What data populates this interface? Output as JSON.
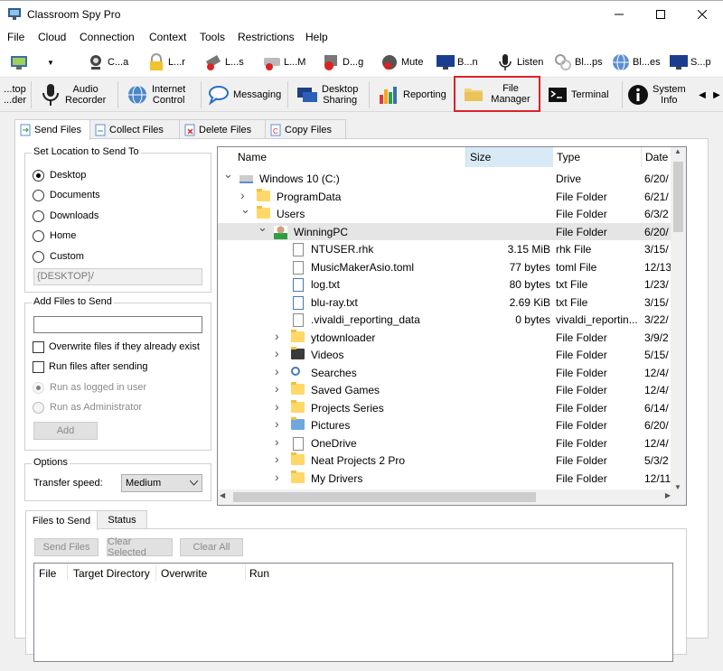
{
  "window": {
    "title": "Classroom Spy Pro"
  },
  "menu": [
    "File",
    "Cloud",
    "Connection",
    "Context",
    "Tools",
    "Restrictions",
    "Help"
  ],
  "toolbar": [
    {
      "label": "",
      "icon": "monitor-icon",
      "has_dropdown": true
    },
    {
      "label": "C...a",
      "icon": "webcam-icon",
      "has_dropdown": true
    },
    {
      "label": "L...r",
      "icon": "lock-icon"
    },
    {
      "label": "L...s",
      "icon": "usb-block-icon"
    },
    {
      "label": "L...M",
      "icon": "drive-block-icon"
    },
    {
      "label": "D...g",
      "icon": "block-icon"
    },
    {
      "label": "Mute",
      "icon": "mute-icon"
    },
    {
      "label": "B...n",
      "icon": "blank-screen-icon"
    },
    {
      "label": "Listen",
      "icon": "microphone-icon"
    },
    {
      "label": "Bl...ps",
      "icon": "block-apps-icon"
    },
    {
      "label": "Bl...es",
      "icon": "block-websites-icon"
    },
    {
      "label": "S...p",
      "icon": "shutdown-icon"
    }
  ],
  "ribbon": [
    {
      "label": "...top\n...der",
      "icon": "desktop-recorder-icon"
    },
    {
      "label": "Audio\nRecorder",
      "icon": "microphone-icon"
    },
    {
      "label": "Internet\nControl",
      "icon": "globe-icon"
    },
    {
      "label": "Messaging",
      "icon": "chat-icon"
    },
    {
      "label": "Desktop\nSharing",
      "icon": "desktop-share-icon"
    },
    {
      "label": "Reporting",
      "icon": "bar-chart-icon"
    },
    {
      "label": "File\nManager",
      "icon": "folder-icon",
      "active": true
    },
    {
      "label": "Terminal",
      "icon": "terminal-icon"
    },
    {
      "label": "System\nInfo",
      "icon": "info-icon"
    }
  ],
  "subtabs": [
    "Send Files",
    "Collect Files",
    "Delete Files",
    "Copy Files"
  ],
  "send_location": {
    "title": "Set Location to Send To",
    "options": [
      "Desktop",
      "Documents",
      "Downloads",
      "Home",
      "Custom"
    ],
    "selected": "Desktop",
    "custom_path": "{DESKTOP}/"
  },
  "add_files": {
    "title": "Add Files to Send",
    "input_value": "",
    "overwrite_label": "Overwrite files if they already exist",
    "run_label": "Run files after sending",
    "run_as_user": "Run as logged in user",
    "run_as_admin": "Run as Administrator",
    "add_button": "Add"
  },
  "options": {
    "title": "Options",
    "transfer_speed_label": "Transfer speed:",
    "transfer_speed": "Medium"
  },
  "file_tree": {
    "columns": [
      "Name",
      "Size",
      "Type",
      "Date"
    ],
    "rows": [
      {
        "name": "Windows 10 (C:)",
        "size": "",
        "type": "Drive",
        "date": "6/20/",
        "level": 0,
        "expander": "expanded",
        "icon": "drive"
      },
      {
        "name": "ProgramData",
        "size": "",
        "type": "File Folder",
        "date": "6/21/",
        "level": 1,
        "expander": "collapsed",
        "icon": "folder"
      },
      {
        "name": "Users",
        "size": "",
        "type": "File Folder",
        "date": "6/3/2",
        "level": 1,
        "expander": "expanded",
        "icon": "folder"
      },
      {
        "name": "WinningPC",
        "size": "",
        "type": "File Folder",
        "date": "6/20/",
        "level": 2,
        "expander": "expanded",
        "icon": "user",
        "selected": true
      },
      {
        "name": "NTUSER.rhk",
        "size": "3.15 MiB",
        "type": "rhk File",
        "date": "3/15/",
        "level": 3,
        "expander": "",
        "icon": "file"
      },
      {
        "name": "MusicMakerAsio.toml",
        "size": "77 bytes",
        "type": "toml File",
        "date": "12/13",
        "level": 3,
        "expander": "",
        "icon": "file"
      },
      {
        "name": "log.txt",
        "size": "80 bytes",
        "type": "txt File",
        "date": "1/23/",
        "level": 3,
        "expander": "",
        "icon": "textfile"
      },
      {
        "name": "blu-ray.txt",
        "size": "2.69 KiB",
        "type": "txt File",
        "date": "3/15/",
        "level": 3,
        "expander": "",
        "icon": "textfile"
      },
      {
        "name": ".vivaldi_reporting_data",
        "size": "0 bytes",
        "type": "vivaldi_reportin...",
        "date": "3/22/",
        "level": 3,
        "expander": "",
        "icon": "file"
      },
      {
        "name": "ytdownloader",
        "size": "",
        "type": "File Folder",
        "date": "3/9/2",
        "level": 3,
        "expander": "collapsed",
        "icon": "folder"
      },
      {
        "name": "Videos",
        "size": "",
        "type": "File Folder",
        "date": "5/15/",
        "level": 3,
        "expander": "collapsed",
        "icon": "video-folder"
      },
      {
        "name": "Searches",
        "size": "",
        "type": "File Folder",
        "date": "12/4/",
        "level": 3,
        "expander": "collapsed",
        "icon": "search"
      },
      {
        "name": "Saved Games",
        "size": "",
        "type": "File Folder",
        "date": "12/4/",
        "level": 3,
        "expander": "collapsed",
        "icon": "games-folder"
      },
      {
        "name": "Projects Series",
        "size": "",
        "type": "File Folder",
        "date": "6/14/",
        "level": 3,
        "expander": "collapsed",
        "icon": "folder"
      },
      {
        "name": "Pictures",
        "size": "",
        "type": "File Folder",
        "date": "6/20/",
        "level": 3,
        "expander": "collapsed",
        "icon": "pictures-folder"
      },
      {
        "name": "OneDrive",
        "size": "",
        "type": "File Folder",
        "date": "12/4/",
        "level": 3,
        "expander": "collapsed",
        "icon": "file"
      },
      {
        "name": "Neat Projects 2 Pro",
        "size": "",
        "type": "File Folder",
        "date": "5/3/2",
        "level": 3,
        "expander": "collapsed",
        "icon": "folder"
      },
      {
        "name": "My Drivers",
        "size": "",
        "type": "File Folder",
        "date": "12/11",
        "level": 3,
        "expander": "collapsed",
        "icon": "folder"
      }
    ]
  },
  "bottom_tabs": [
    "Files to Send",
    "Status"
  ],
  "bottom_buttons": [
    "Send Files",
    "Clear Selected",
    "Clear All"
  ],
  "send_list": {
    "columns": [
      "File",
      "Target Directory",
      "Overwrite",
      "Run"
    ]
  },
  "colors": {
    "highlight_box": "#e0202a",
    "selected_row": "#e5e5e5",
    "size_column_header": "#d9eaf7"
  }
}
